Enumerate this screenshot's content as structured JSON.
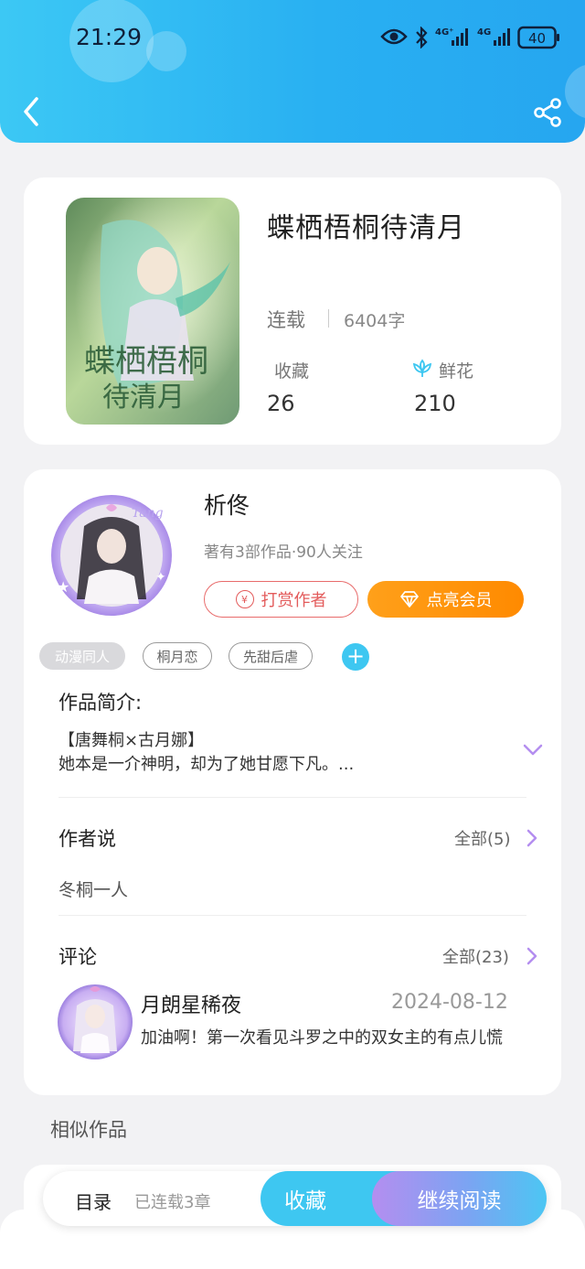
{
  "status_bar": {
    "time": "21:29",
    "battery": "40"
  },
  "book": {
    "title": "蝶栖梧桐待清月",
    "status": "连载",
    "word_count": "6404字",
    "favorites_label": "收藏",
    "favorites_count": "26",
    "flowers_label": "鲜花",
    "flowers_count": "210"
  },
  "author": {
    "name": "析佟",
    "meta": "著有3部作品·90人关注",
    "reward_label": "打赏作者",
    "vip_label": "点亮会员",
    "yen_glyph": "¥"
  },
  "tags": [
    "动漫同人",
    "桐月恋",
    "先甜后虐"
  ],
  "tag_add": "+",
  "intro": {
    "label": "作品简介:",
    "line1": "【唐舞桐×古月娜】",
    "line2": "她本是一介神明，却为了她甘愿下凡。..."
  },
  "author_says": {
    "label": "作者说",
    "all_label": "全部(5)",
    "text": "冬桐一人"
  },
  "comments": {
    "label": "评论",
    "all_label": "全部(23)",
    "items": [
      {
        "user": "月朗星稀夜",
        "date": "2024-08-12",
        "text": "加油啊！第一次看见斗罗之中的双女主的有点儿慌"
      }
    ]
  },
  "similar_label": "相似作品",
  "bottom_bar": {
    "toc_label": "目录",
    "chapters_label": "已连载3章",
    "collect_label": "收藏",
    "read_label": "继续阅读"
  },
  "colors": {
    "header_start": "#3cc8f4",
    "header_end": "#26a6f0",
    "reward": "#e35b5b",
    "vip": "#ff8a00",
    "accent_blue": "#3ec7f1",
    "accent_purple": "#b48ef0"
  },
  "icons": [
    "back-icon",
    "share-icon",
    "eye-icon",
    "bluetooth-icon",
    "signal-icon",
    "battery-icon",
    "flower-icon",
    "yen-icon",
    "diamond-icon",
    "add-tag-icon",
    "chevron-down-icon",
    "chevron-right-icon"
  ]
}
